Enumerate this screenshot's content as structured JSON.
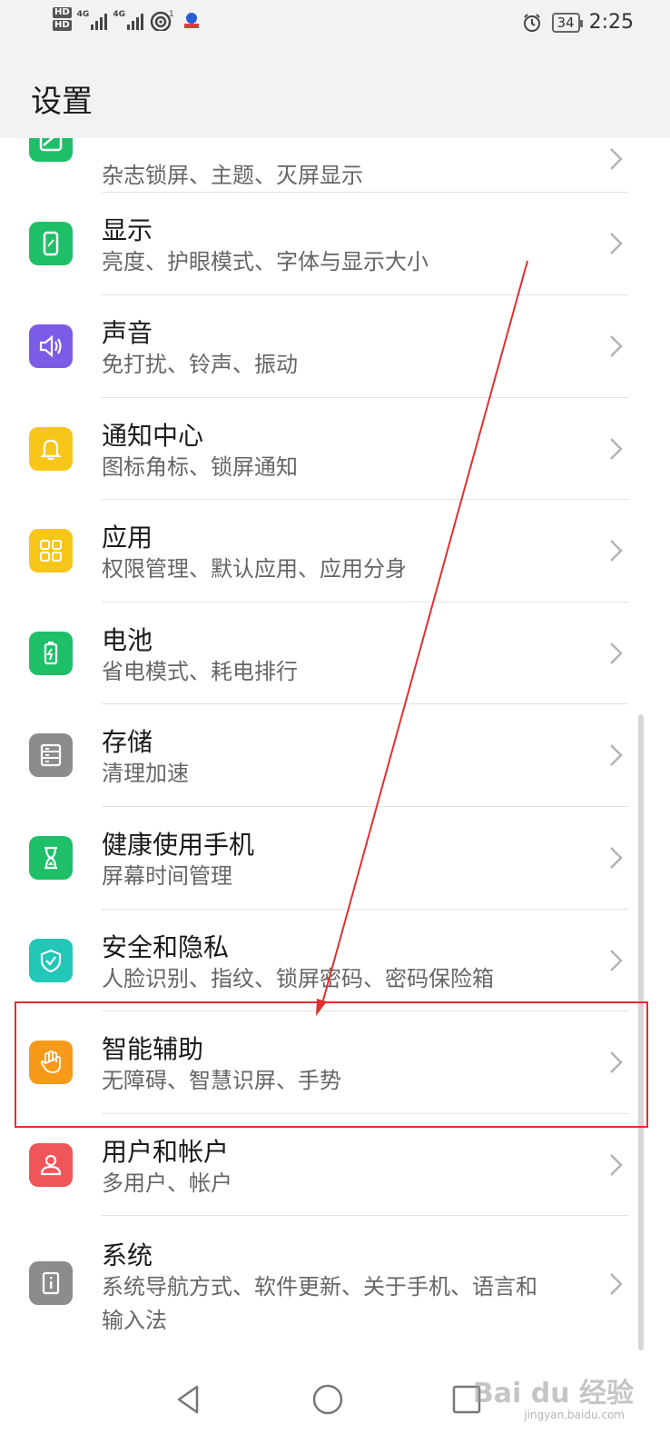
{
  "status_bar": {
    "hd1": "HD",
    "hd2": "HD",
    "net1": "4G",
    "net2": "4G",
    "hotspot_count": "1",
    "battery": "34",
    "time": "2:25",
    "icons": [
      "signal-icon",
      "wifi-icon",
      "app-notification-icon",
      "alarm-icon",
      "battery-icon"
    ]
  },
  "header": {
    "title": "设置"
  },
  "items": [
    {
      "title": "",
      "subtitle": "杂志锁屏、主题、灭屏显示",
      "icon": "desktop-wallpaper-icon",
      "color": "#1fbf6a"
    },
    {
      "title": "显示",
      "subtitle": "亮度、护眼模式、字体与显示大小",
      "icon": "display-icon",
      "color": "#1fbf6a"
    },
    {
      "title": "声音",
      "subtitle": "免打扰、铃声、振动",
      "icon": "speaker-icon",
      "color": "#7b5ce6"
    },
    {
      "title": "通知中心",
      "subtitle": "图标角标、锁屏通知",
      "icon": "bell-icon",
      "color": "#f7c619"
    },
    {
      "title": "应用",
      "subtitle": "权限管理、默认应用、应用分身",
      "icon": "apps-grid-icon",
      "color": "#f7c619"
    },
    {
      "title": "电池",
      "subtitle": "省电模式、耗电排行",
      "icon": "battery-icon",
      "color": "#1fbf6a"
    },
    {
      "title": "存储",
      "subtitle": "清理加速",
      "icon": "storage-icon",
      "color": "#8c8c8c"
    },
    {
      "title": "健康使用手机",
      "subtitle": "屏幕时间管理",
      "icon": "hourglass-icon",
      "color": "#1fbf6a"
    },
    {
      "title": "安全和隐私",
      "subtitle": "人脸识别、指纹、锁屏密码、密码保险箱",
      "icon": "shield-icon",
      "color": "#22c7b8"
    },
    {
      "title": "智能辅助",
      "subtitle": "无障碍、智慧识屏、手势",
      "icon": "hand-icon",
      "color": "#f79a1a"
    },
    {
      "title": "用户和帐户",
      "subtitle": "多用户、帐户",
      "icon": "user-icon",
      "color": "#f0555a"
    },
    {
      "title": "系统",
      "subtitle": "系统导航方式、软件更新、关于手机、语言和",
      "subtitle2": "输入法",
      "icon": "info-icon",
      "color": "#8c8c8c"
    }
  ],
  "annotation": {
    "color": "#e0302f"
  },
  "navbar": {
    "icons": [
      "back-icon",
      "home-icon",
      "recents-icon"
    ]
  },
  "watermark": {
    "text": "Bai du 经验",
    "sub": "jingyan.baidu.com"
  }
}
